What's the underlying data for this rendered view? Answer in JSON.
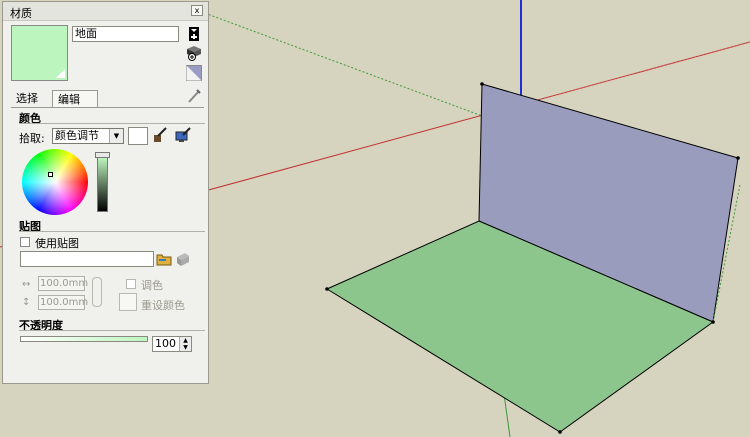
{
  "viewport": {
    "ground_color": "#8dc68d",
    "wall_color": "#999cbd",
    "background_color": "#d6d3bf"
  },
  "panel": {
    "title": "材质",
    "close_label": "x",
    "material_name": "地面",
    "swatch_color": "#bdf5bf",
    "tabs": {
      "select_label": "选择",
      "edit_label": "编辑"
    },
    "color": {
      "heading": "颜色",
      "picker_label": "拾取:",
      "picker_value": "颜色调节"
    },
    "texture": {
      "heading": "贴图",
      "use_texture_label": "使用贴图",
      "width_value": "100.0mm",
      "height_value": "100.0mm",
      "colorize_label": "调色",
      "reset_color_label": "重设颜色"
    },
    "opacity": {
      "heading": "不透明度",
      "value": "100"
    }
  }
}
